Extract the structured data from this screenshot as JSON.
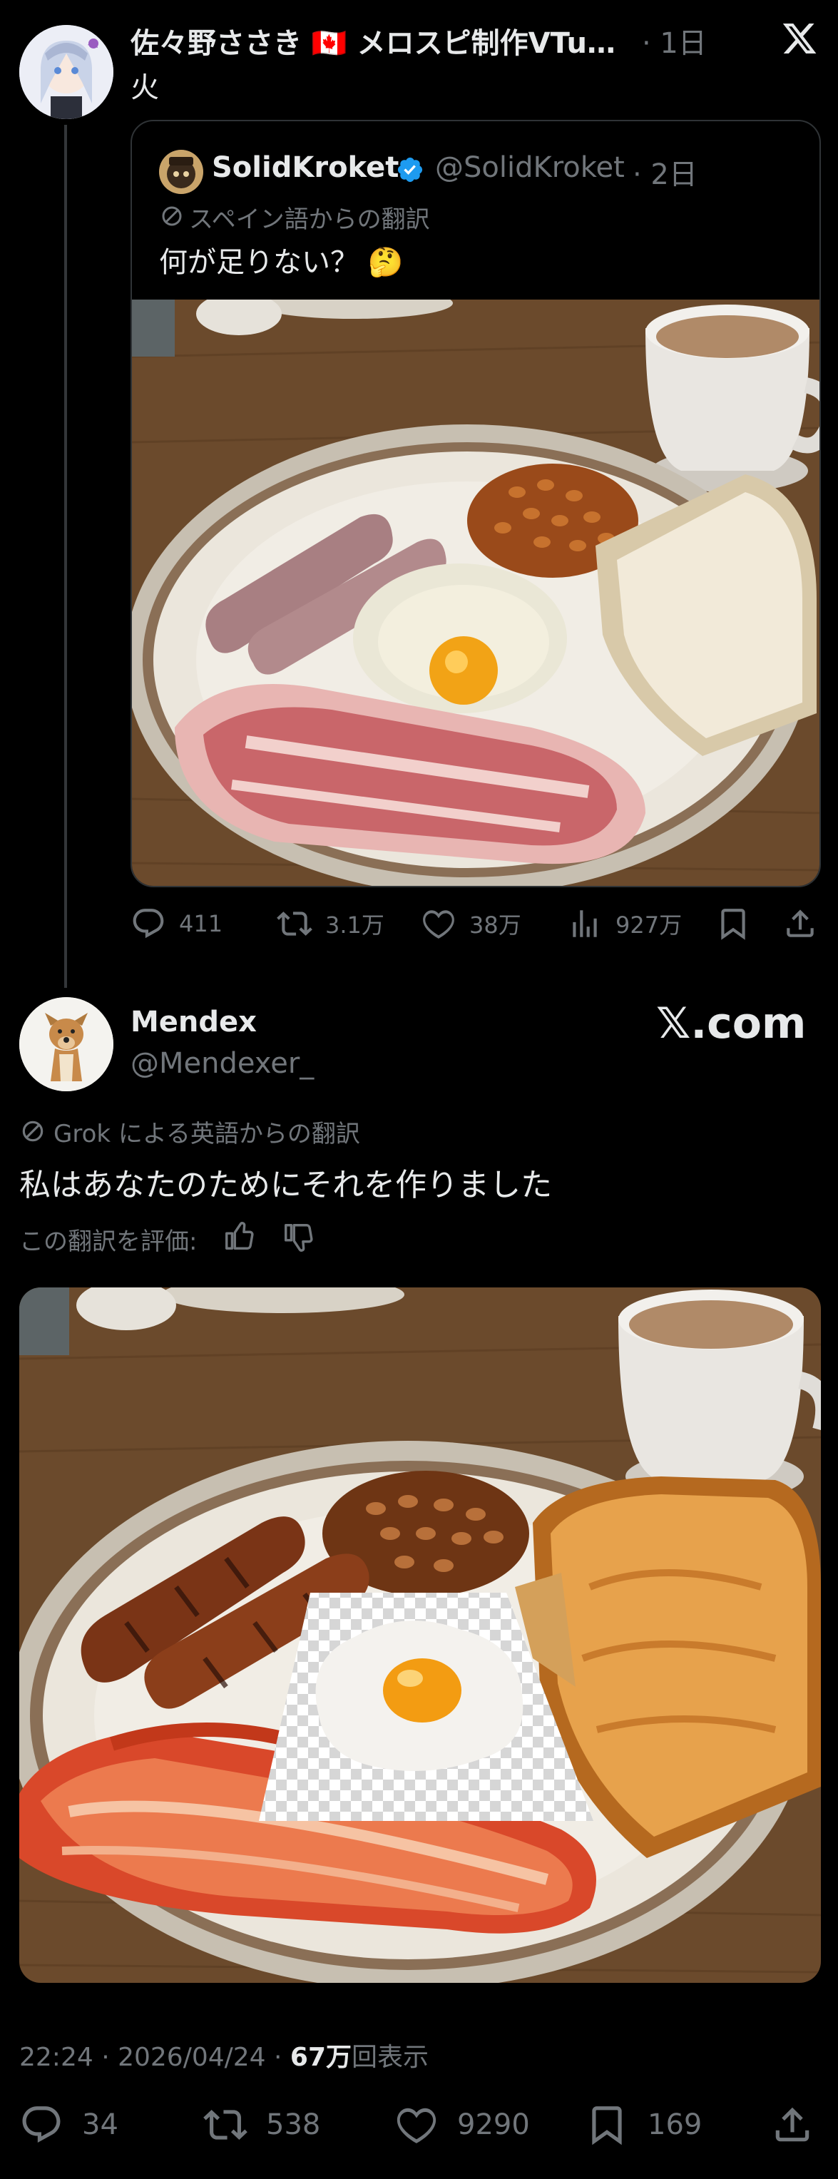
{
  "colors": {
    "background": "#000000",
    "text": "#e7e9ea",
    "muted": "#71767b",
    "border": "#2f3336",
    "verified": "#1d9bf0"
  },
  "top_post": {
    "author_name": "佐々野ささき 🇨🇦 メロスピ制作VTu…",
    "time": "· 1日",
    "text": "火",
    "close_icon": "x-logo-icon"
  },
  "quoted_post": {
    "author_name": "SolidKroket",
    "handle": "@SolidKroket",
    "time": "· 2日",
    "translation_label": "スペイン語からの翻訳",
    "text": "何が足りない？ 🤔"
  },
  "top_stats": {
    "replies": "411",
    "reposts": "3.1万",
    "likes": "38万",
    "views": "927万"
  },
  "reply_post": {
    "author_name": "Mendex",
    "handle": "@Mendexer_",
    "watermark": "𝕏.com",
    "translation_label": "Grok による英語からの翻訳",
    "text": "私はあなたのためにそれを作りました",
    "rate_label": "この翻訳を評価:",
    "timestamp": "22:24 · 2026/04/24 · ",
    "views_count": "67万",
    "views_label": "回表示"
  },
  "reply_stats": {
    "replies": "34",
    "reposts": "538",
    "likes": "9290",
    "bookmarks": "169"
  }
}
